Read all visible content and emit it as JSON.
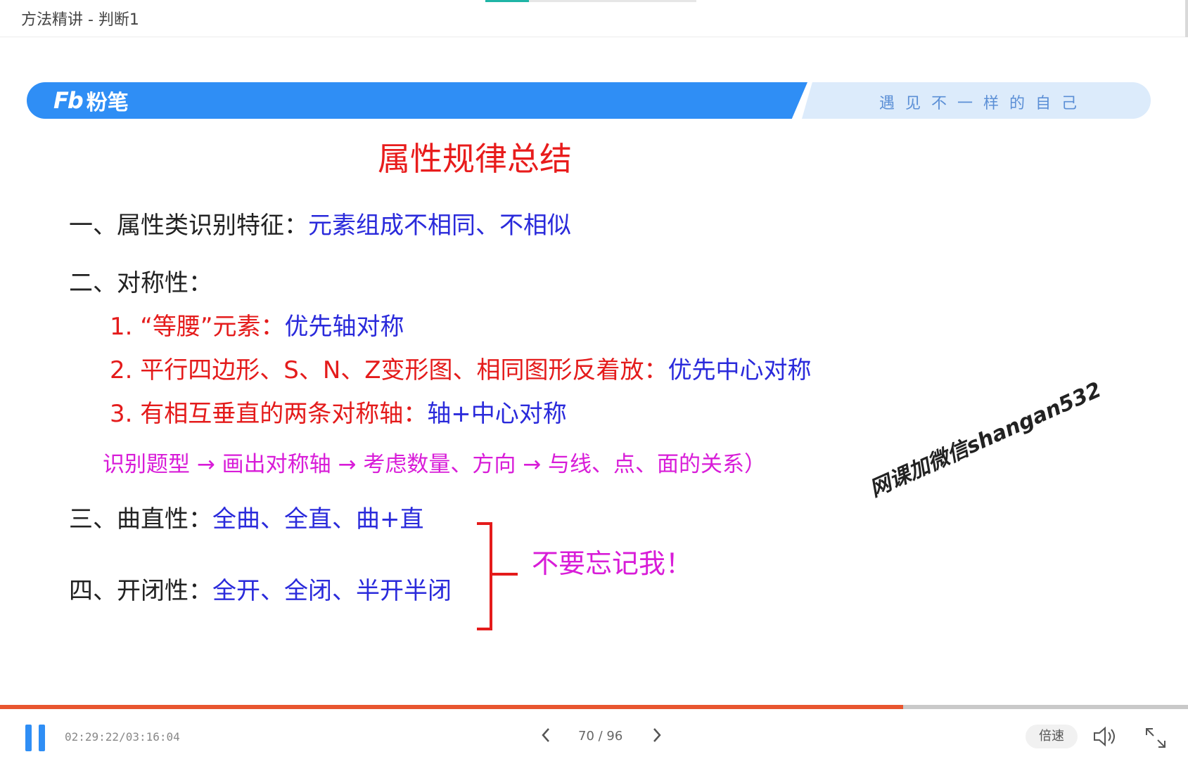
{
  "window": {
    "title": "方法精讲 - 判断1"
  },
  "banner": {
    "logo_mark": "Fb",
    "logo_name": "粉笔",
    "slogan": "遇见不一样的自己"
  },
  "slide": {
    "title": "属性规律总结",
    "items": [
      {
        "lead": "一、属性类识别特征：",
        "detail": "元素组成不相同、不相似"
      },
      {
        "lead": "二、对称性："
      },
      {
        "lead": "1. “等腰”元素：",
        "detail": "优先轴对称"
      },
      {
        "lead": "2. 平行四边形、S、N、Z变形图、相同图形反着放：",
        "detail": "优先中心对称"
      },
      {
        "lead": "3. 有相互垂直的两条对称轴：",
        "detail": "轴+中心对称"
      },
      {
        "lead": "识别题型 → 画出对称轴 → 考虑数量、方向 → 与线、点、面的关系）"
      },
      {
        "lead": "三、曲直性：",
        "detail": "全曲、全直、曲+直"
      },
      {
        "lead": "四、开闭性：",
        "detail": "全开、全闭、半开半闭"
      }
    ],
    "reminder": "不要忘记我！",
    "watermark": "网课加微信shangan532"
  },
  "player": {
    "time": "02:29:22/03:16:04",
    "progress_percent": 76,
    "page": "70 / 96",
    "prev_icon": "chevron-left",
    "next_icon": "chevron-right",
    "speed_label": "倍速",
    "volume_icon": "speaker",
    "fullscreen_icon": "expand",
    "accent_color": "#2f8ef5",
    "progress_color": "#e8552f"
  }
}
